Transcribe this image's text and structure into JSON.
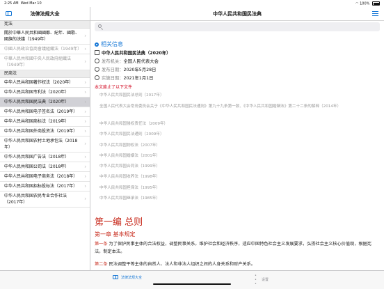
{
  "status": {
    "time": "2:25 AM",
    "date": "Wed Mar 10",
    "battery": "100%"
  },
  "sidebar": {
    "title": "法律法规大全",
    "section1": "宪法",
    "items1": [
      {
        "label": "關於中華人民共和國國都、紀年、國歌、國旗的決議（1949年）",
        "style": ""
      },
      {
        "label": "中國人民政治協商會議組織法（1949年）",
        "style": "gray"
      },
      {
        "label": "中華人民共和國中央人民政府組織法（1949年）",
        "style": "gray"
      }
    ],
    "section2": "民商法",
    "items2": [
      {
        "label": "中华人民共和国著作权法（2020年）",
        "style": ""
      },
      {
        "label": "中华人民共和国专利法（2020年）",
        "style": ""
      },
      {
        "label": "中华人民共和国民法典（2020年）",
        "style": "selected"
      },
      {
        "label": "中华人民共和国电子签名法（2019年）",
        "style": ""
      },
      {
        "label": "中华人民共和国商标法（2019年）",
        "style": ""
      },
      {
        "label": "中华人民共和国外商投资法（2019年）",
        "style": ""
      },
      {
        "label": "中华人民共和国农村土地承包法（2018年）",
        "style": ""
      },
      {
        "label": "中华人民共和国广告法（2018年）",
        "style": ""
      },
      {
        "label": "中华人民共和国公司法（2018年）",
        "style": ""
      },
      {
        "label": "中华人民共和国电子商务法（2018年）",
        "style": ""
      },
      {
        "label": "中华人民共和国招标投标法（2017年）",
        "style": ""
      },
      {
        "label": "中华人民共和国农民专业合作社法（2017年）",
        "style": ""
      }
    ]
  },
  "main": {
    "title": "中华人民共和国民法典",
    "search_placeholder": "",
    "info_heading": "相关信息",
    "law_name": "中华人民共和国民法典（2020年）",
    "publisher_label": "发布机关：",
    "publisher": "全国人民代表大会",
    "publish_date_label": "发布日期：",
    "publish_date": "2020年5月28日",
    "effective_date_label": "实施日期：",
    "effective_date": "2021年1月1日",
    "abolish_note": "本文废止了以下文件",
    "related": [
      "中华人民共和国民法总则（2017年）",
      "全国人民代表大会常务委员会关于《中华人民共和国民法通则》第九十九条第一款、《中华人民共和国婚姻法》第二十二条的解释（2014年）",
      "中华人民共和国侵权责任法（2009年）",
      "中华人民共和国民法通则（2009年）",
      "中华人民共和国物权法（2007年）",
      "中华人民共和国婚姻法（2001年）",
      "中华人民共和国合同法（1999年）",
      "中华人民共和国收养法（1998年）",
      "中华人民共和国担保法（1995年）",
      "中华人民共和国继承法（1985年）"
    ],
    "part_title": "第一编 总则",
    "chapter_title": "第一章 基本规定",
    "articles": [
      {
        "no": "第一条",
        "text": " 为了保护民事主体的合法权益，调整民事关系，维护社会和经济秩序，适应中国特色社会主义发展要求，弘扬社会主义核心价值观，根据宪法，制定本法。"
      },
      {
        "no": "第二条",
        "text": " 民法调整平等主体的自然人、法人和非法人组织之间的人身关系和财产关系。"
      }
    ]
  },
  "tabbar": {
    "tab1": "法律法规大全",
    "tab2": "设置"
  },
  "colors": {
    "accent": "#1677d6",
    "heading_red": "#c7281a",
    "abolish_red": "#d0021b"
  }
}
